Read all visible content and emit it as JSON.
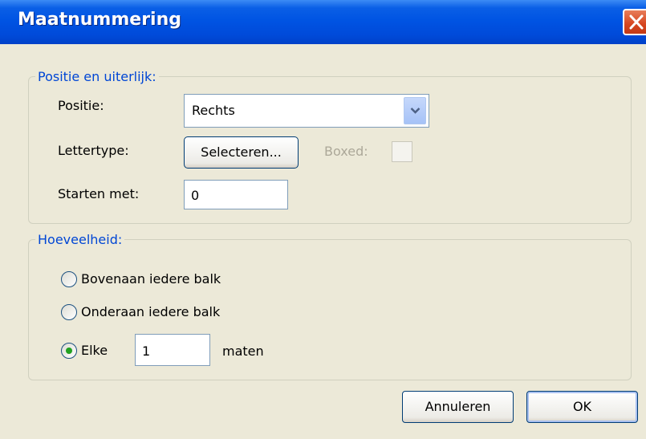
{
  "window": {
    "title": "Maatnummering"
  },
  "position_group": {
    "legend": "Positie en uiterlijk:",
    "position_label": "Positie:",
    "position_value": "Rechts",
    "font_label": "Lettertype:",
    "select_button": "Selecteren...",
    "boxed_label": "Boxed:",
    "boxed_checked": false,
    "start_label": "Starten met:",
    "start_value": "0"
  },
  "amount_group": {
    "legend": "Hoeveelheid:",
    "option_top": "Bovenaan iedere balk",
    "option_bottom": "Onderaan iedere balk",
    "option_every": "Elke",
    "every_value": "1",
    "every_unit": "maten",
    "selected": "option_every"
  },
  "buttons": {
    "cancel": "Annuleren",
    "ok": "OK"
  }
}
